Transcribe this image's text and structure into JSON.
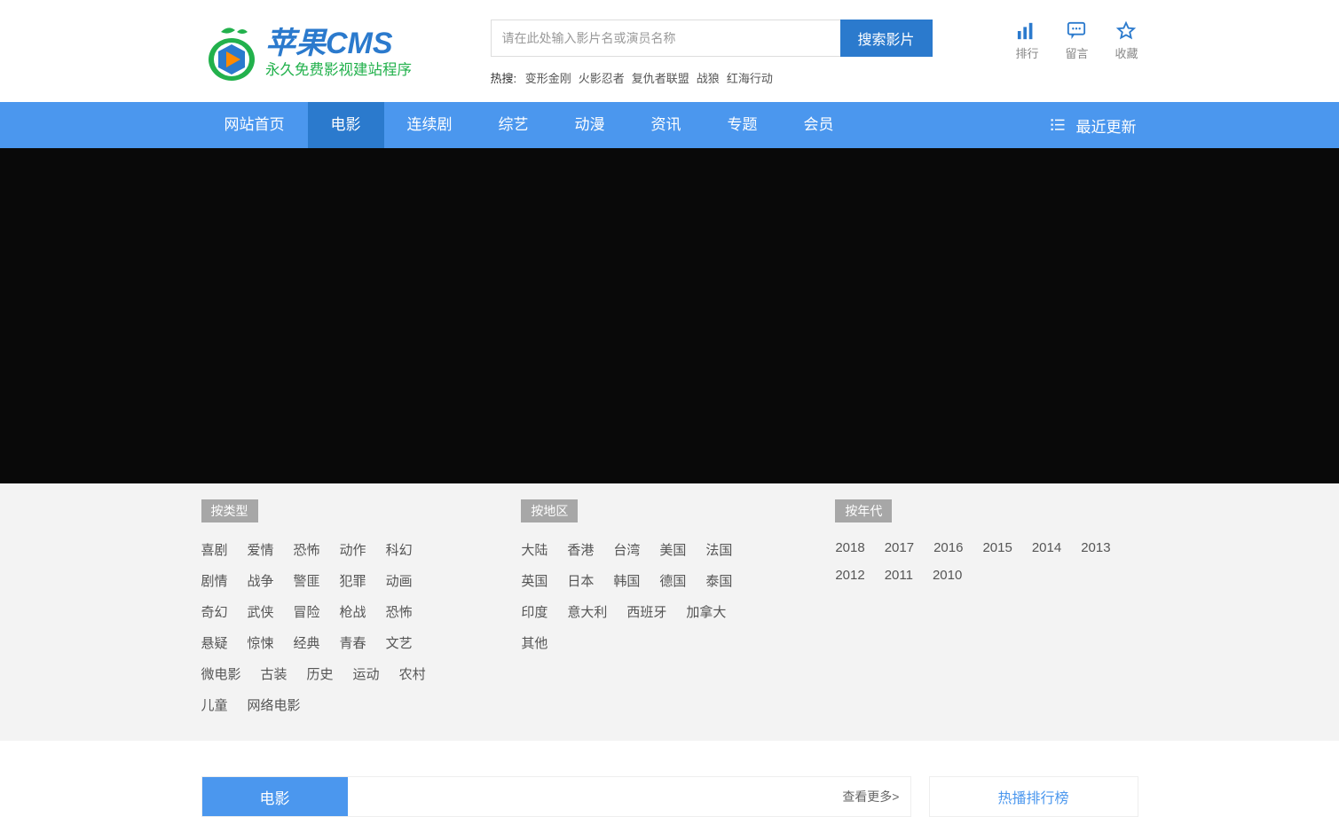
{
  "logo": {
    "line1": "苹果CMS",
    "line2": "永久免费影视建站程序"
  },
  "search": {
    "placeholder": "请在此处输入影片名或演员名称",
    "button": "搜索影片"
  },
  "hot": {
    "label": "热搜:",
    "items": [
      "变形金刚",
      "火影忍者",
      "复仇者联盟",
      "战狼",
      "红海行动"
    ]
  },
  "topIcons": [
    {
      "name": "rank",
      "label": "排行"
    },
    {
      "name": "msg",
      "label": "留言"
    },
    {
      "name": "fav",
      "label": "收藏"
    }
  ],
  "nav": {
    "items": [
      "网站首页",
      "电影",
      "连续剧",
      "综艺",
      "动漫",
      "资讯",
      "专题",
      "会员"
    ],
    "active": 1,
    "recent": "最近更新"
  },
  "filters": {
    "type": {
      "label": "按类型",
      "items": [
        "喜剧",
        "爱情",
        "恐怖",
        "动作",
        "科幻",
        "剧情",
        "战争",
        "警匪",
        "犯罪",
        "动画",
        "奇幻",
        "武侠",
        "冒险",
        "枪战",
        "恐怖",
        "悬疑",
        "惊悚",
        "经典",
        "青春",
        "文艺",
        "微电影",
        "古装",
        "历史",
        "运动",
        "农村",
        "儿童",
        "网络电影"
      ]
    },
    "region": {
      "label": "按地区",
      "items": [
        "大陆",
        "香港",
        "台湾",
        "美国",
        "法国",
        "英国",
        "日本",
        "韩国",
        "德国",
        "泰国",
        "印度",
        "意大利",
        "西班牙",
        "加拿大",
        "其他"
      ]
    },
    "year": {
      "label": "按年代",
      "items": [
        "2018",
        "2017",
        "2016",
        "2015",
        "2014",
        "2013",
        "2012",
        "2011",
        "2010"
      ]
    }
  },
  "bottom": {
    "tab": "电影",
    "more": "查看更多>",
    "rank": "热播排行榜"
  }
}
